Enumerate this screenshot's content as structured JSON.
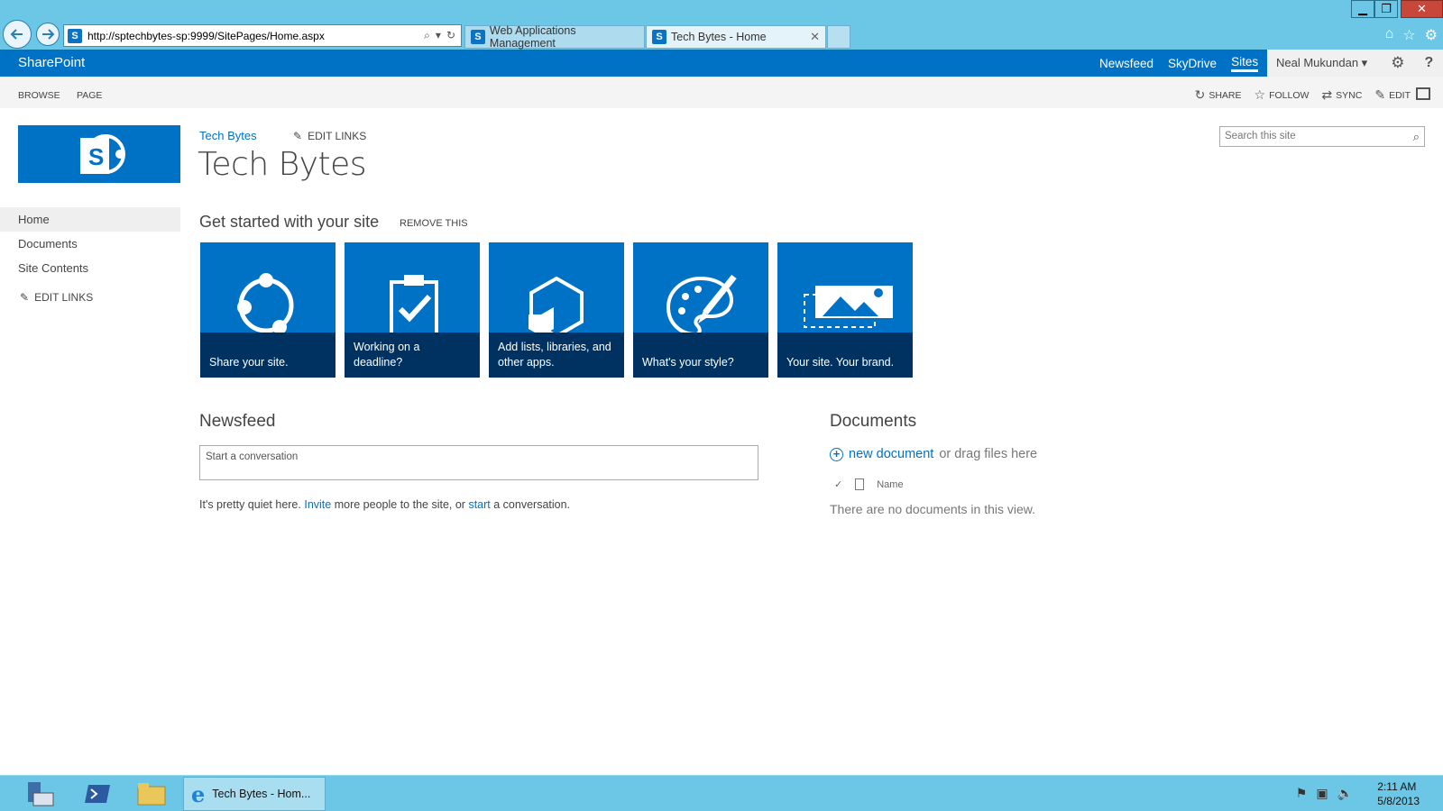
{
  "browser": {
    "address_url": "http://sptechbytes-sp:9999/SitePages/Home.aspx",
    "tabs": [
      {
        "label": "Web Applications Management"
      },
      {
        "label": "Tech Bytes - Home"
      }
    ]
  },
  "suitebar": {
    "brand": "SharePoint",
    "links": [
      "Newsfeed",
      "SkyDrive",
      "Sites"
    ],
    "active_link": "Sites",
    "user_name": "Neal Mukundan ▾"
  },
  "ribbon": {
    "tabs": [
      "BROWSE",
      "PAGE"
    ],
    "actions": [
      "SHARE",
      "FOLLOW",
      "SYNC",
      "EDIT"
    ]
  },
  "nav": {
    "breadcrumb": "Tech Bytes",
    "edit_links": "EDIT LINKS",
    "quicklaunch": [
      "Home",
      "Documents",
      "Site Contents"
    ],
    "quicklaunch_edit": "EDIT LINKS"
  },
  "page": {
    "title": "Tech Bytes",
    "search_placeholder": "Search this site"
  },
  "getstarted": {
    "heading": "Get started with your site",
    "remove": "REMOVE THIS",
    "tiles": [
      {
        "caption": "Share your site.",
        "icon": "share-circle-icon"
      },
      {
        "caption": "Working on a deadline?",
        "icon": "clipboard-check-icon"
      },
      {
        "caption": "Add lists, libraries, and other apps.",
        "icon": "hexagon-apps-icon"
      },
      {
        "caption": "What's your style?",
        "icon": "palette-icon"
      },
      {
        "caption": "Your site. Your brand.",
        "icon": "picture-brand-icon"
      }
    ]
  },
  "newsfeed": {
    "heading": "Newsfeed",
    "placeholder": "Start a conversation",
    "quiet_prefix": "It's pretty quiet here.",
    "quiet_invite": "Invite",
    "quiet_middle": "more people to the site, or",
    "quiet_start": "start",
    "quiet_suffix": "a conversation."
  },
  "documents": {
    "heading": "Documents",
    "new_doc": "new document",
    "drag_text": "or drag files here",
    "col_name": "Name",
    "empty": "There are no documents in this view."
  },
  "taskbar": {
    "ie_label": "Tech Bytes - Hom...",
    "time": "2:11 AM",
    "date": "5/8/2013"
  },
  "colors": {
    "accent": "#0072c6",
    "chrome": "#6cc7e6",
    "tile_caption": "#002044"
  }
}
